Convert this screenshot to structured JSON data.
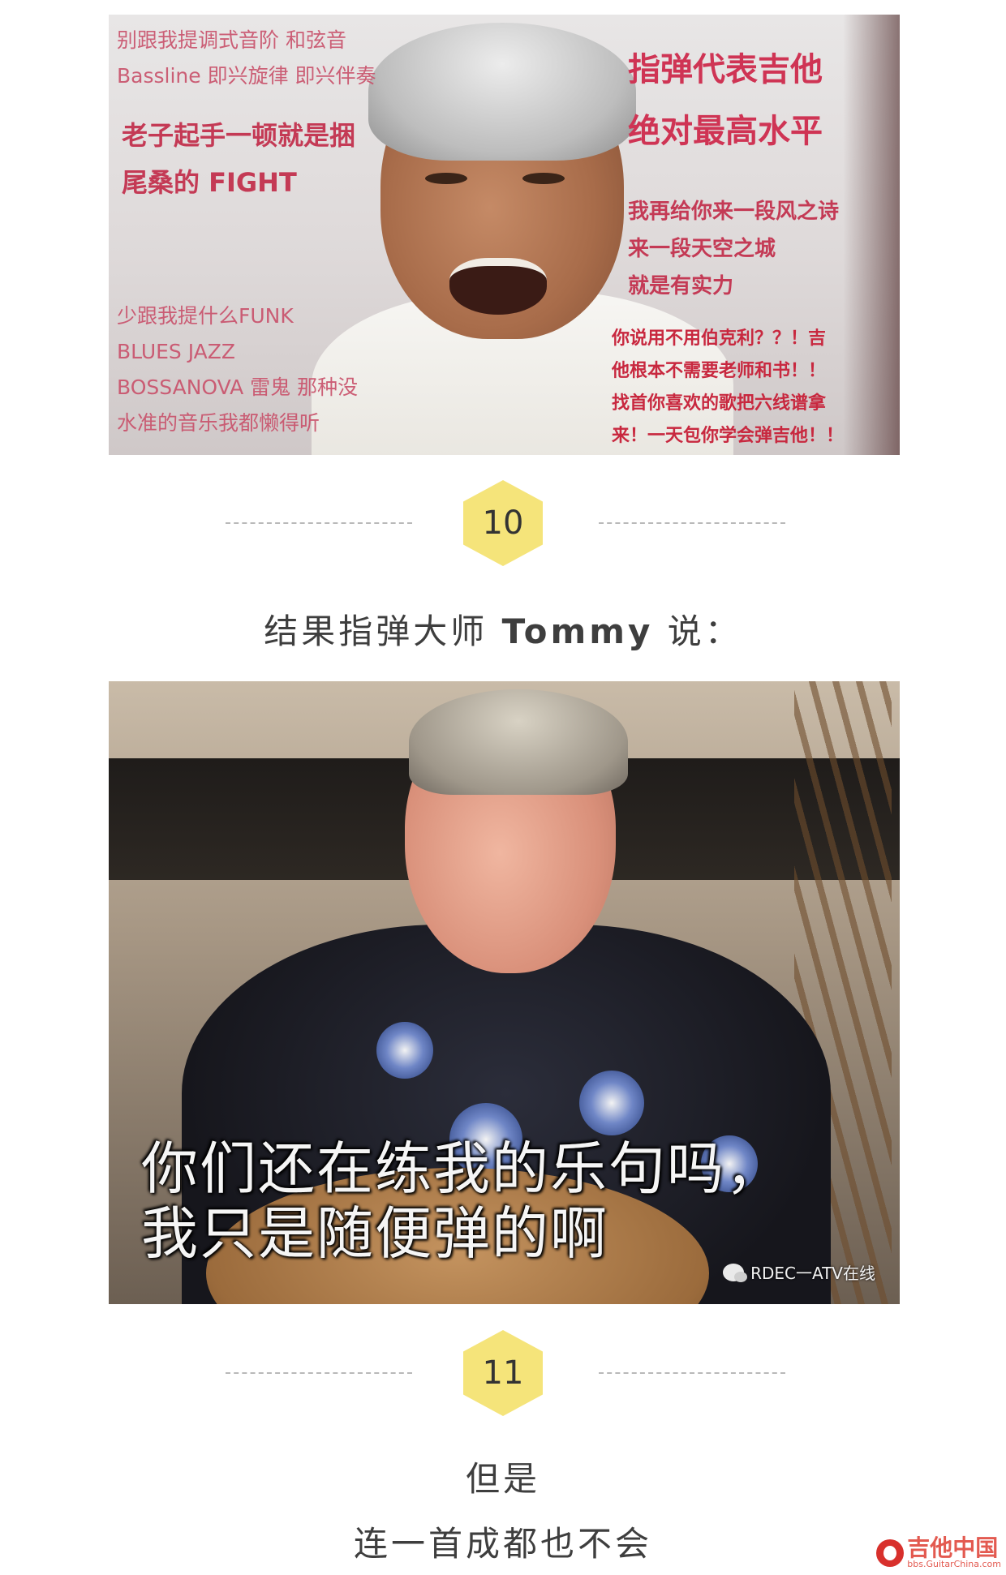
{
  "meme1": {
    "left_top_lines": [
      "别跟我提调式音阶 和弦音",
      "Bassline 即兴旋律 即兴伴奏"
    ],
    "left_mid_lines": [
      "老子起手一顿就是捆",
      "尾桑的 FIGHT"
    ],
    "left_bottom_lines": [
      "少跟我提什么FUNK",
      "BLUES JAZZ",
      "BOSSANOVA 雷鬼 那种没",
      "水准的音乐我都懒得听"
    ],
    "right_top_lines": [
      "指弹代表吉他",
      "绝对最高水平"
    ],
    "right_mid_lines": [
      "我再给你来一段风之诗",
      "来一段天空之城",
      "就是有实力"
    ],
    "right_bottom_lines": [
      "你说用不用伯克利？？！吉",
      "他根本不需要老师和书！！",
      "找首你喜欢的歌把六线谱拿",
      "来！一天包你学会弹吉他！！"
    ]
  },
  "divider1": {
    "number": "10"
  },
  "text1": {
    "prefix": "结果指弹大师 ",
    "name": "Tommy",
    "suffix": " 说："
  },
  "meme2": {
    "caption_line1": "你们还在练我的乐句吗，",
    "caption_line2": "我只是随便弹的啊",
    "watermark": "RDEC一ATV在线"
  },
  "divider2": {
    "number": "11"
  },
  "text2": {
    "line1": "但是",
    "line2": "连一首成都也不会"
  },
  "logo": {
    "title": "吉他中国",
    "url": "bbs.GuitarChina.com"
  },
  "colors": {
    "hex_badge": "#f5e47a",
    "meme_pink": "#cf3454",
    "logo_red": "#d8302c"
  }
}
